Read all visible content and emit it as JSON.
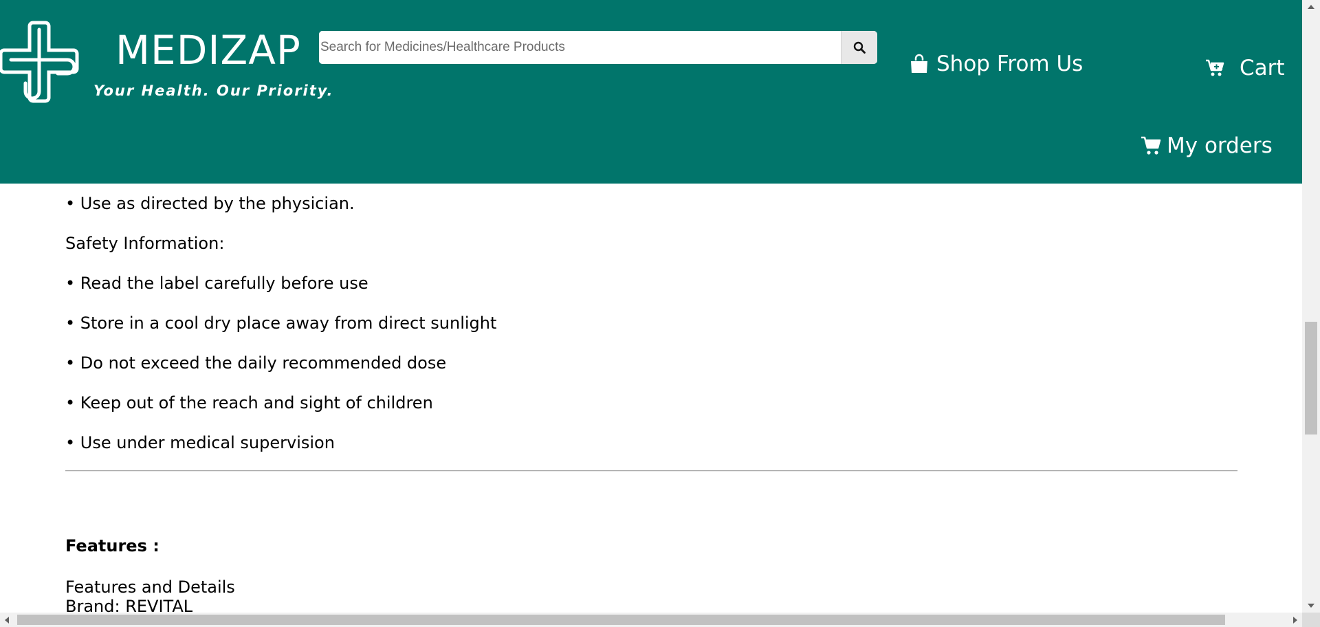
{
  "header": {
    "brand_name": "MEDIZAP",
    "tagline": "Your Health. Our Priority.",
    "logo_icon": "medical-cross-logo-icon",
    "background_color": "#01756b",
    "search": {
      "placeholder": "Search for Medicines/Healthcare Products",
      "value": "",
      "button_icon": "search-icon"
    },
    "nav": {
      "shop_label": "Shop From Us",
      "shop_icon": "shopping-bag-icon",
      "cart_label": "Cart",
      "cart_icon": "cart-plus-icon",
      "orders_label": "My orders",
      "orders_icon": "shopping-cart-icon"
    }
  },
  "content": {
    "lines": [
      "• Use as directed by the physician.",
      "Safety Information:",
      "• Read the label carefully before use",
      "• Store in a cool dry place away from direct sunlight",
      "• Do not exceed the daily recommended dose",
      "• Keep out of the reach and sight of children",
      "• Use under medical supervision"
    ],
    "features_title": "Features :",
    "features_subtitle": "Features and Details",
    "brand_line": "Brand: REVITAL"
  }
}
